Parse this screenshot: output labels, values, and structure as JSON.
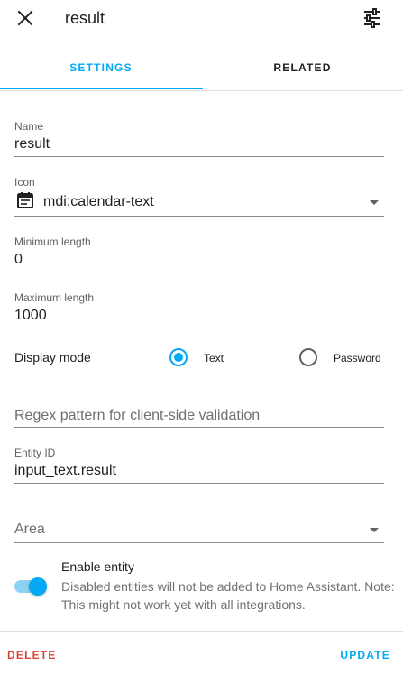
{
  "header": {
    "title": "result",
    "close_icon": "close-icon",
    "settings_icon": "tune-icon"
  },
  "tabs": [
    {
      "label": "SETTINGS",
      "active": true
    },
    {
      "label": "RELATED",
      "active": false
    }
  ],
  "form": {
    "name": {
      "label": "Name",
      "value": "result"
    },
    "icon": {
      "label": "Icon",
      "value": "mdi:calendar-text",
      "icon": "calendar-text-icon"
    },
    "min_length": {
      "label": "Minimum length",
      "value": "0"
    },
    "max_length": {
      "label": "Maximum length",
      "value": "1000"
    },
    "display_mode": {
      "label": "Display mode",
      "options": [
        {
          "label": "Text",
          "selected": true
        },
        {
          "label": "Password",
          "selected": false
        }
      ]
    },
    "regex": {
      "placeholder": "Regex pattern for client-side validation",
      "value": ""
    },
    "entity_id": {
      "label": "Entity ID",
      "value": "input_text.result"
    },
    "area": {
      "placeholder": "Area",
      "value": ""
    },
    "enable": {
      "title": "Enable entity",
      "description": "Disabled entities will not be added to Home Assistant. Note: This might not work yet with all integrations.",
      "enabled": true
    }
  },
  "footer": {
    "delete_label": "DELETE",
    "update_label": "UPDATE"
  },
  "colors": {
    "accent": "#03a9f4",
    "danger": "#db4437"
  }
}
